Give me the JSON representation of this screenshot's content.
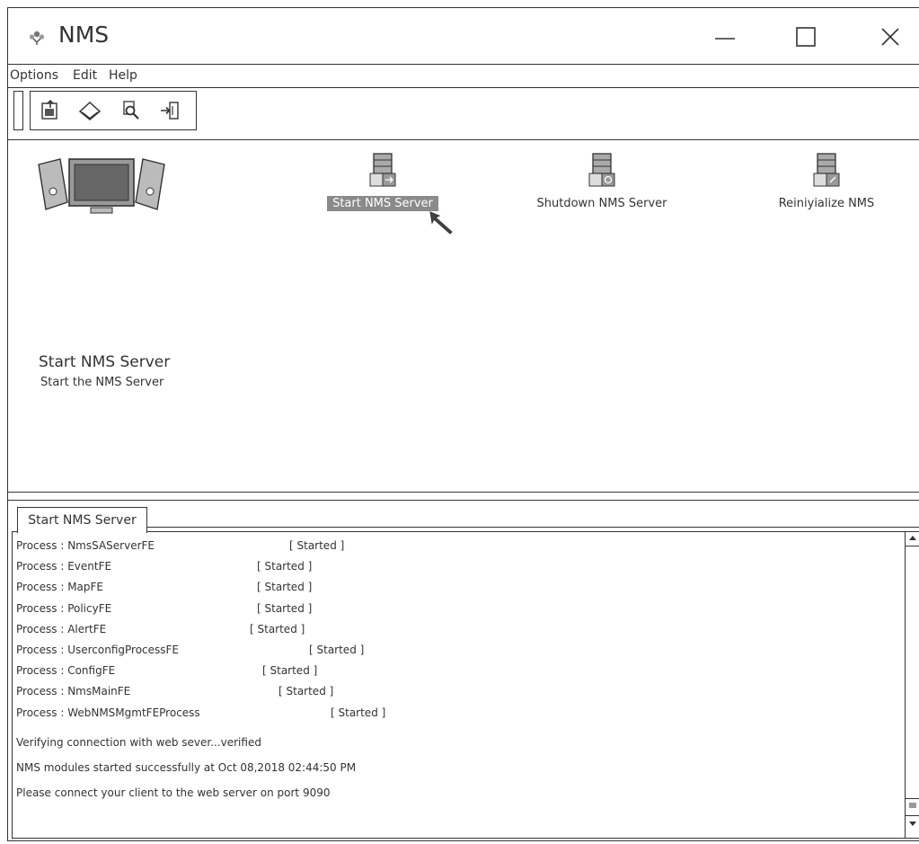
{
  "window": {
    "title": "NMS"
  },
  "menu": [
    "Options",
    "Edit",
    "Help"
  ],
  "toolbar": {
    "icons": [
      "document-export-icon",
      "eraser-icon",
      "search-icon",
      "exit-icon"
    ]
  },
  "hero": {
    "title": "Start NMS Server",
    "subtitle": "Start the NMS Server"
  },
  "actions": [
    {
      "label": "Start NMS Server",
      "selected": true
    },
    {
      "label": "Shutdown NMS Server",
      "selected": false
    },
    {
      "label": "Reiniyialize NMS",
      "selected": false
    }
  ],
  "log": {
    "tab": "Start NMS Server",
    "processes": [
      {
        "name": "Process : NmsSAServerFE",
        "status": "[ Started ]"
      },
      {
        "name": "Process : EventFE",
        "status": "[ Started ]"
      },
      {
        "name": "Process : MapFE",
        "status": "[ Started ]"
      },
      {
        "name": "Process : PolicyFE",
        "status": "[ Started ]"
      },
      {
        "name": "Process : AlertFE",
        "status": "[ Started ]"
      },
      {
        "name": "Process : UserconfigProcessFE",
        "status": "[ Started ]"
      },
      {
        "name": "Process : ConfigFE",
        "status": "[ Started ]"
      },
      {
        "name": "Process : NmsMainFE",
        "status": "[ Started ]"
      },
      {
        "name": "Process : WebNMSMgmtFEProcess",
        "status": "[ Started ]"
      }
    ],
    "messages": [
      "Verifying connection with web sever...verified",
      "NMS modules started successfully at Oct 08,2018 02:44:50 PM",
      "Please connect your client to the web server on port 9090"
    ]
  }
}
